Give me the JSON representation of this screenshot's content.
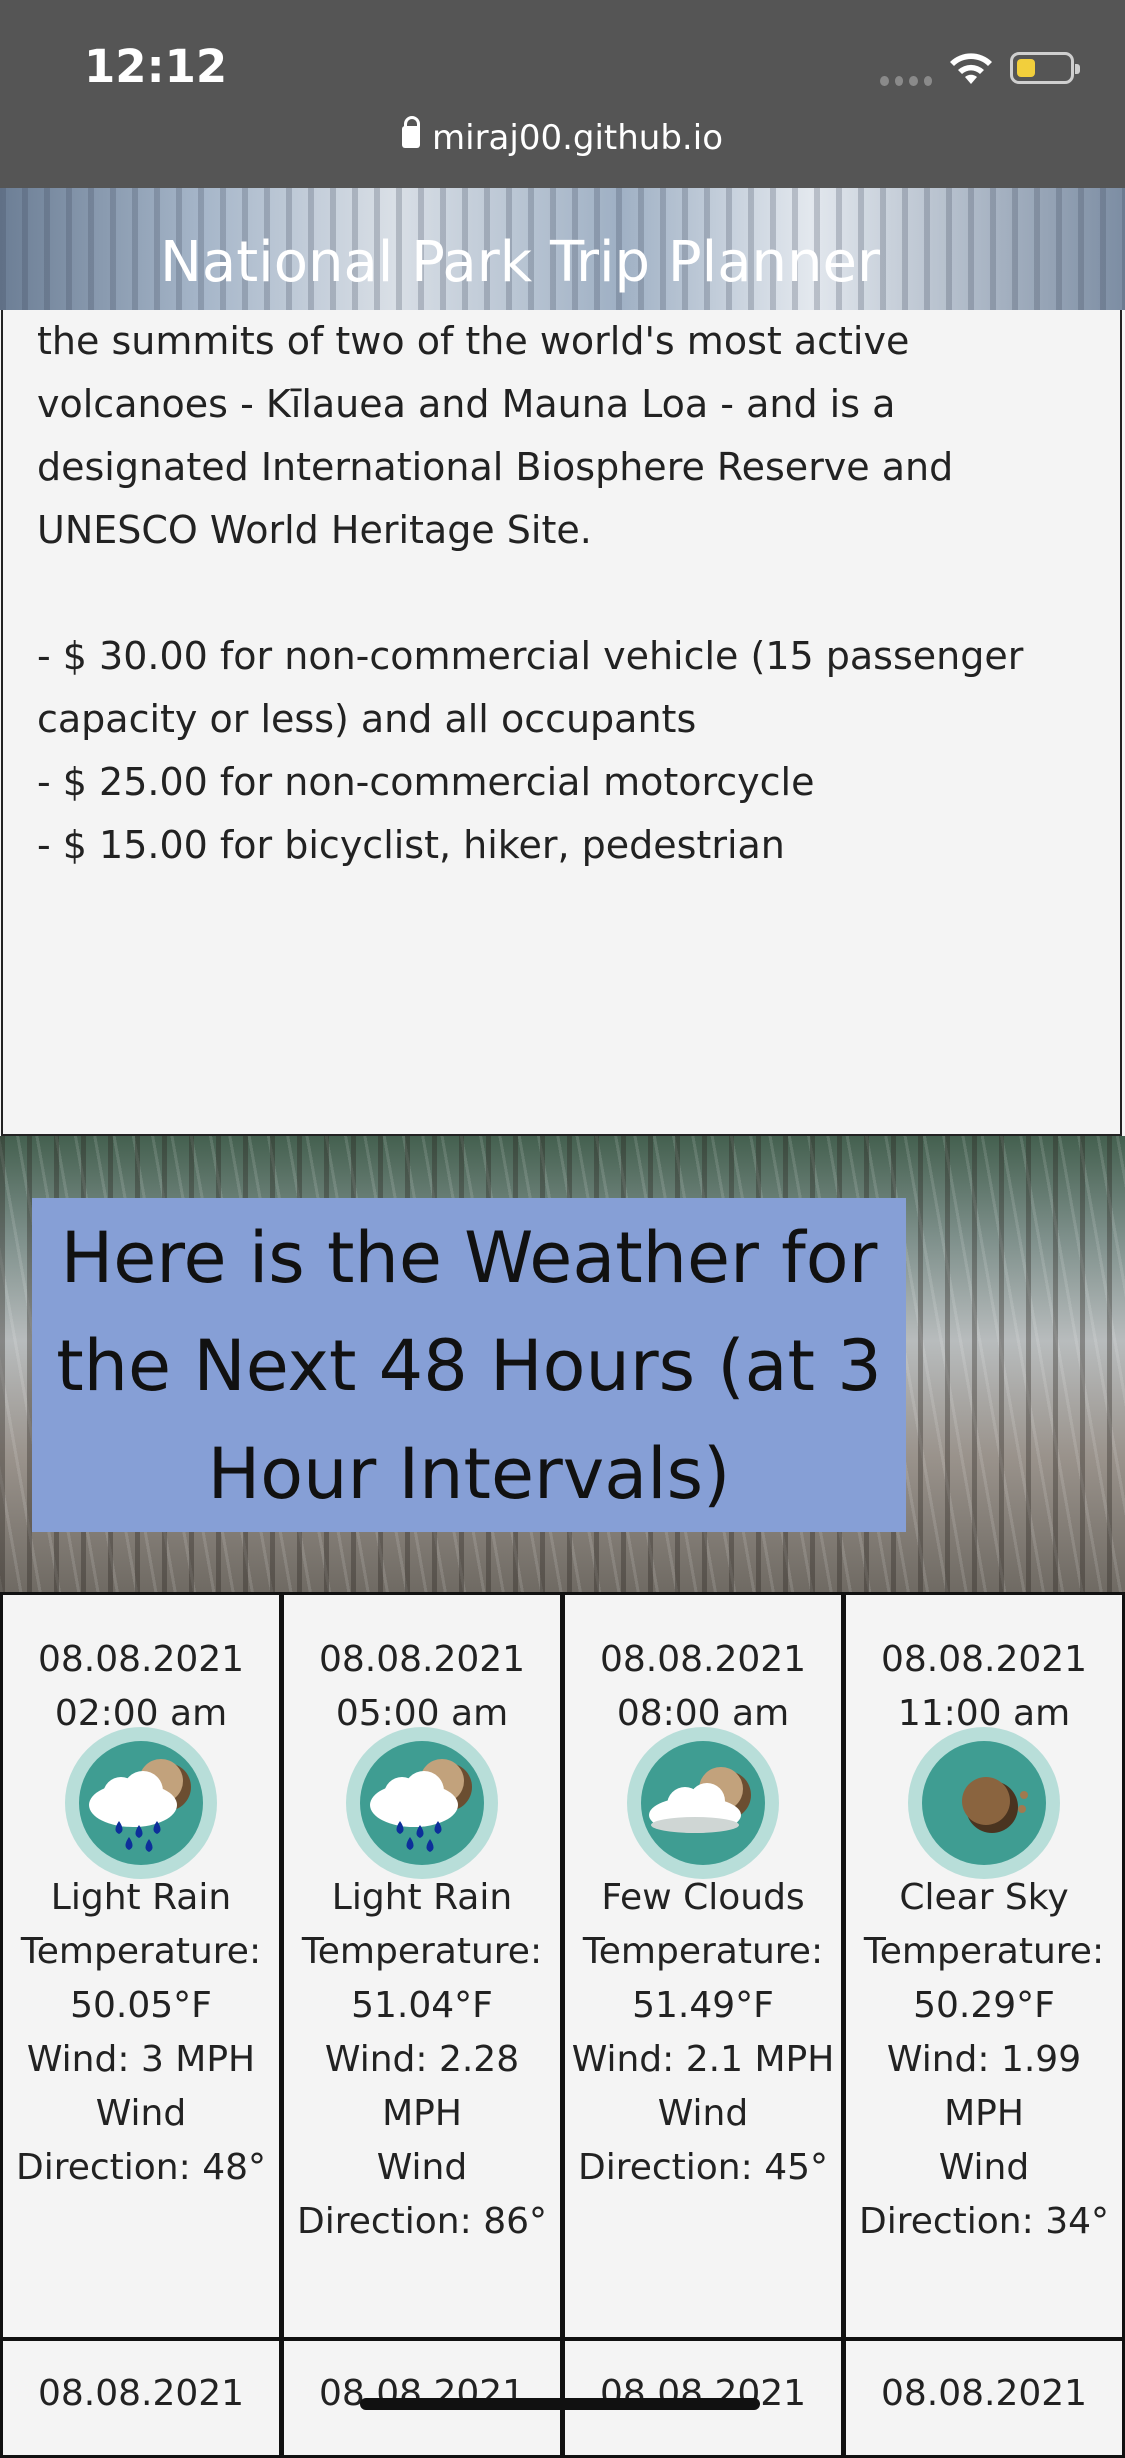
{
  "status_bar": {
    "time": "12:12",
    "url": "miraj00.github.io"
  },
  "header": {
    "title": "National Park Trip Planner"
  },
  "park_info": {
    "description_lines": [
      "the summits of two of the world's most active",
      "volcanoes - Kīlauea and Mauna Loa - and is a",
      "designated International Biosphere Reserve and",
      "UNESCO World Heritage Site."
    ],
    "fees": [
      "- $ 30.00 for non-commercial vehicle (15 passenger capacity or less) and all occupants",
      "- $ 25.00 for non-commercial motorcycle",
      "- $ 15.00 for bicyclist, hiker, pedestrian"
    ]
  },
  "weather": {
    "heading": "Here is the Weather for the Next 48 Hours (at 3 Hour Intervals)",
    "forecasts": [
      {
        "date": "08.08.2021",
        "time": "02:00 am",
        "icon": "rain-cloud-icon",
        "condition": "Light Rain",
        "temperature": "50.05°F",
        "wind": "3 MPH",
        "direction": "48°"
      },
      {
        "date": "08.08.2021",
        "time": "05:00 am",
        "icon": "rain-cloud-icon",
        "condition": "Light Rain",
        "temperature": "51.04°F",
        "wind": "2.28 MPH",
        "direction": "86°"
      },
      {
        "date": "08.08.2021",
        "time": "08:00 am",
        "icon": "few-clouds-icon",
        "condition": "Few Clouds",
        "temperature": "51.49°F",
        "wind": "2.1 MPH",
        "direction": "45°"
      },
      {
        "date": "08.08.2021",
        "time": "11:00 am",
        "icon": "clear-sky-icon",
        "condition": "Clear Sky",
        "temperature": "50.29°F",
        "wind": "1.99 MPH",
        "direction": "34°"
      }
    ],
    "next_row_dates": [
      "08.08.2021",
      "08.08.2021",
      "08.08.2021",
      "08.08.2021"
    ]
  },
  "labels": {
    "temperature": "Temperature:",
    "wind": "Wind:",
    "wind_direction": "Wind Direction:"
  }
}
